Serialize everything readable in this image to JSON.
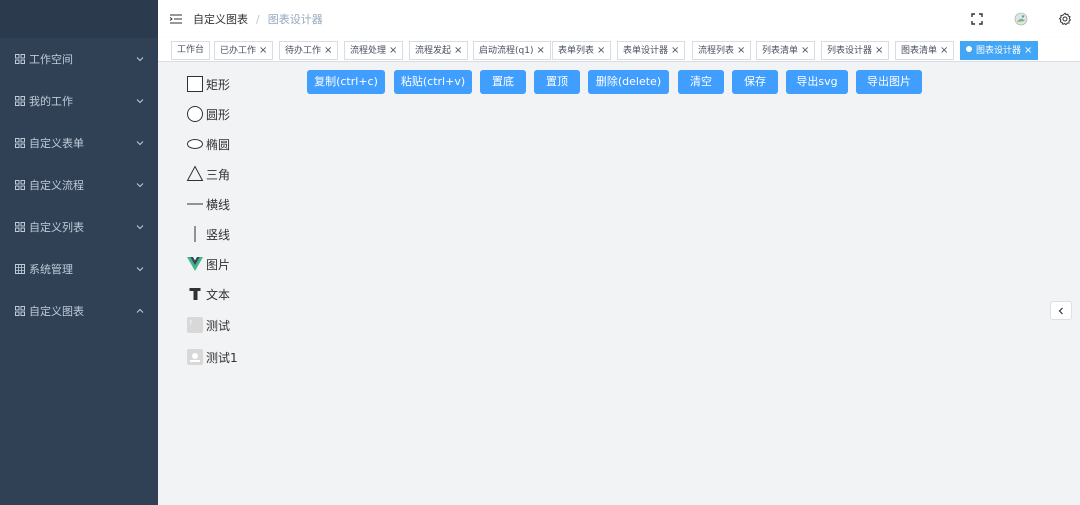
{
  "sidebar": {
    "items": [
      {
        "label": "工作空间",
        "icon": "grid-icon"
      },
      {
        "label": "我的工作",
        "icon": "grid-icon"
      },
      {
        "label": "自定义表单",
        "icon": "grid-icon"
      },
      {
        "label": "自定义流程",
        "icon": "grid-icon"
      },
      {
        "label": "自定义列表",
        "icon": "grid-icon"
      },
      {
        "label": "系统管理",
        "icon": "table-icon"
      },
      {
        "label": "自定义图表",
        "icon": "grid-icon",
        "expanded": true
      }
    ]
  },
  "header": {
    "breadcrumb": [
      "自定义图表",
      "图表设计器"
    ],
    "separator": "/"
  },
  "tags": [
    {
      "label": "工作台"
    },
    {
      "label": "已办工作",
      "close": "×"
    },
    {
      "label": "待办工作",
      "close": "×"
    },
    {
      "label": "流程处理",
      "close": "×"
    },
    {
      "label": "流程发起",
      "close": "×"
    },
    {
      "label": "启动流程(q1)",
      "close": "×"
    },
    {
      "label": "表单列表",
      "close": "×"
    },
    {
      "label": "表单设计器",
      "close": "×"
    },
    {
      "label": "流程列表",
      "close": "×"
    },
    {
      "label": "列表清单",
      "close": "×"
    },
    {
      "label": "列表设计器",
      "close": "×"
    },
    {
      "label": "图表清单",
      "close": "×"
    },
    {
      "label": "图表设计器",
      "close": "×",
      "active": true
    }
  ],
  "palette": [
    {
      "label": "矩形",
      "icon": "rectangle-icon"
    },
    {
      "label": "圆形",
      "icon": "circle-icon"
    },
    {
      "label": "椭圆",
      "icon": "ellipse-icon"
    },
    {
      "label": "三角",
      "icon": "triangle-icon"
    },
    {
      "label": "横线",
      "icon": "horizontal-line-icon"
    },
    {
      "label": "竖线",
      "icon": "vertical-line-icon"
    },
    {
      "label": "图片",
      "icon": "vue-logo-icon"
    },
    {
      "label": "文本",
      "icon": "text-icon"
    },
    {
      "label": "测试",
      "icon": "broken-image-icon"
    },
    {
      "label": "测试1",
      "icon": "image-placeholder-icon"
    }
  ],
  "toolbar": {
    "copy": "复制(ctrl+c)",
    "paste": "粘贴(ctrl+v)",
    "bottom": "置底",
    "top": "置顶",
    "delete": "删除(delete)",
    "clear": "清空",
    "save": "保存",
    "export_svg": "导出svg",
    "export_image": "导出图片"
  },
  "colors": {
    "sidebar_bg": "#304156",
    "sidebar_text": "#bfcbd9",
    "primary": "#409eff",
    "tag_active": "#42a5f5"
  }
}
